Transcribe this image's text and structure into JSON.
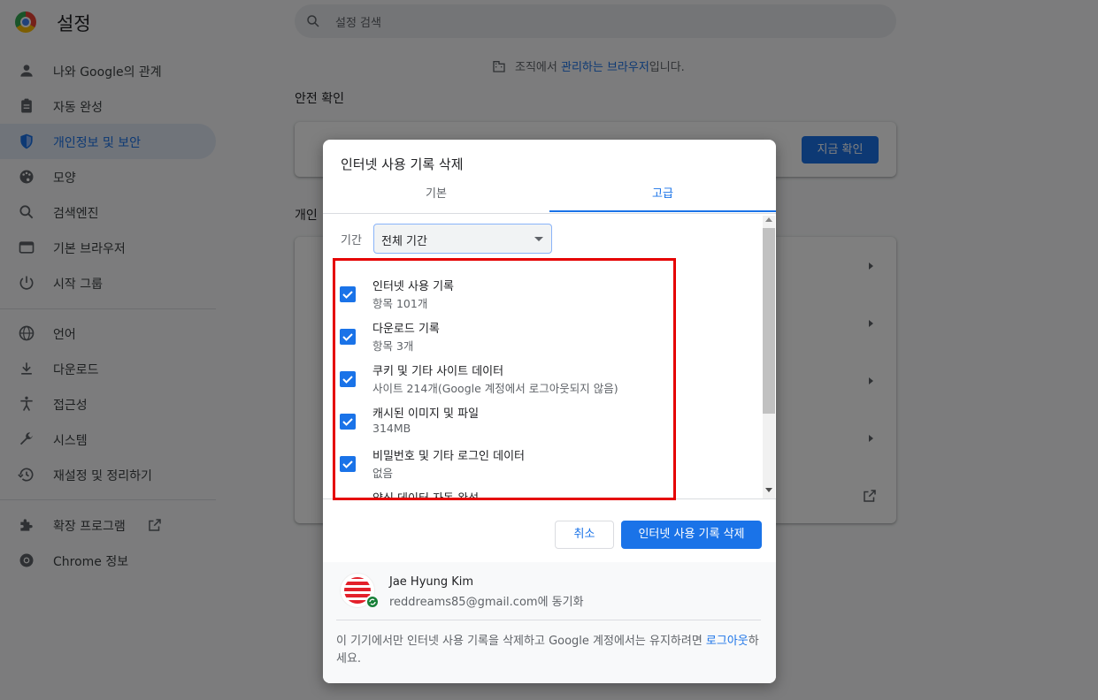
{
  "app": {
    "title": "설정"
  },
  "search": {
    "placeholder": "설정 검색"
  },
  "sidebar": {
    "items": [
      {
        "label": "나와 Google의 관계",
        "icon": "person-icon"
      },
      {
        "label": "자동 완성",
        "icon": "clipboard-icon"
      },
      {
        "label": "개인정보 및 보안",
        "icon": "shield-icon",
        "active": true
      },
      {
        "label": "모양",
        "icon": "palette-icon"
      },
      {
        "label": "검색엔진",
        "icon": "search-icon"
      },
      {
        "label": "기본 브라우저",
        "icon": "browser-icon"
      },
      {
        "label": "시작 그룹",
        "icon": "power-icon"
      },
      {
        "label": "언어",
        "icon": "globe-icon"
      },
      {
        "label": "다운로드",
        "icon": "download-icon"
      },
      {
        "label": "접근성",
        "icon": "accessibility-icon"
      },
      {
        "label": "시스템",
        "icon": "wrench-icon"
      },
      {
        "label": "재설정 및 정리하기",
        "icon": "history-icon"
      },
      {
        "label": "확장 프로그램",
        "icon": "puzzle-icon"
      },
      {
        "label": "Chrome 정보",
        "icon": "chrome-icon"
      }
    ]
  },
  "main": {
    "managed_prefix": "조직에서 ",
    "managed_link": "관리하는 브라우저",
    "managed_suffix": "입니다.",
    "safety_title": "안전 확인",
    "check_now": "지금 확인",
    "privacy_title_partial": "개인"
  },
  "dialog": {
    "title": "인터넷 사용 기록 삭제",
    "tabs": [
      "기본",
      "고급"
    ],
    "active_tab": "고급",
    "period_label": "기간",
    "period_value": "전체 기간",
    "items": [
      {
        "title": "인터넷 사용 기록",
        "sub": "항목 101개",
        "checked": true
      },
      {
        "title": "다운로드 기록",
        "sub": "항목 3개",
        "checked": true
      },
      {
        "title": "쿠키 및 기타 사이트 데이터",
        "sub": "사이트 214개(Google 계정에서 로그아웃되지 않음)",
        "checked": true
      },
      {
        "title": "캐시된 이미지 및 파일",
        "sub": "314MB",
        "checked": true
      },
      {
        "title": "비밀번호 및 기타 로그인 데이터",
        "sub": "없음",
        "checked": true
      },
      {
        "title": "양식 데이터 자동 완성",
        "sub": "",
        "checked": true
      }
    ],
    "cancel_label": "취소",
    "clear_label": "인터넷 사용 기록 삭제",
    "user": {
      "name": "Jae Hyung Kim",
      "email": "reddreams85@gmail.com",
      "sync_suffix": "에 동기화"
    },
    "note_prefix": "이 기기에서만 인터넷 사용 기록을 삭제하고 Google 계정에서는 유지하려면 ",
    "note_link": "로그아웃",
    "note_suffix": "하세요."
  },
  "colors": {
    "accent": "#1a73e8",
    "highlight": "#e50000"
  }
}
